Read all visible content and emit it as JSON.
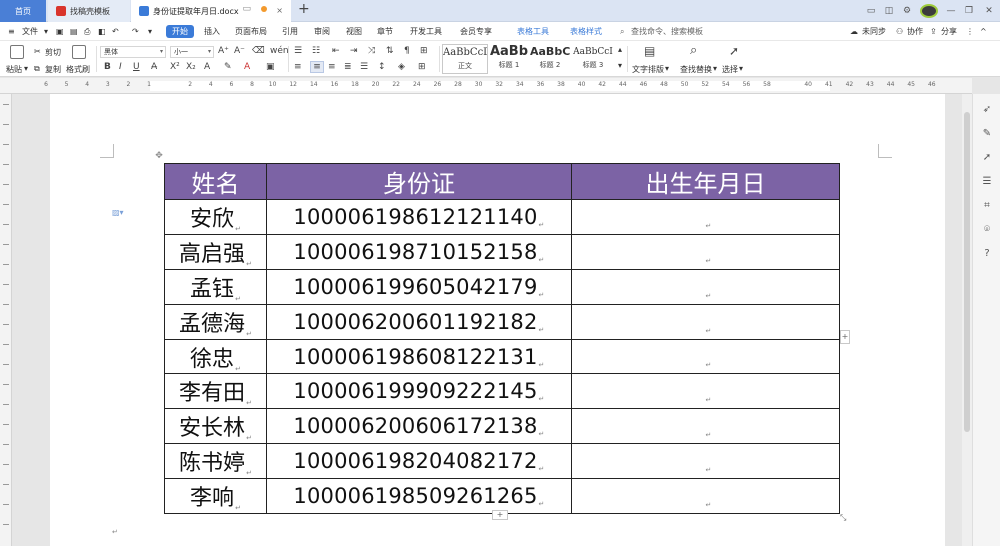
{
  "titlebar": {
    "tabs": [
      {
        "label": "首页"
      },
      {
        "label": "找稿壳模板"
      },
      {
        "label": "身份证提取年月日.docx"
      }
    ],
    "new_tab": "+",
    "close_glyph": "×"
  },
  "menu": {
    "file": "文件",
    "items": [
      "开始",
      "插入",
      "页面布局",
      "引用",
      "审阅",
      "视图",
      "章节",
      "开发工具",
      "会员专享"
    ],
    "context_tabs": [
      "表格工具",
      "表格样式"
    ],
    "search": "查找命令、搜索模板",
    "right": {
      "sync": "未同步",
      "collab": "协作",
      "share": "分享"
    }
  },
  "ribbon": {
    "paste": "粘贴",
    "cut": "剪切",
    "copy": "复制",
    "format_painter": "格式刷",
    "font_name": "黑体",
    "font_size": "小一",
    "styles": [
      {
        "sample": "AaBbCcDd",
        "label": "正文"
      },
      {
        "sample": "AaBb",
        "label": "标题 1"
      },
      {
        "sample": "AaBbC",
        "label": "标题 2"
      },
      {
        "sample": "AaBbCcI",
        "label": "标题 3"
      }
    ],
    "text_layout": "文字排版",
    "find_replace": "查找替换",
    "select": "选择"
  },
  "ruler": {
    "ticks": [
      "6",
      "5",
      "4",
      "3",
      "2",
      "1",
      "",
      "2",
      "4",
      "6",
      "8",
      "10",
      "12",
      "14",
      "16",
      "18",
      "20",
      "22",
      "24",
      "26",
      "28",
      "30",
      "32",
      "34",
      "36",
      "38",
      "40",
      "42",
      "44",
      "46",
      "48",
      "50",
      "52",
      "54",
      "56",
      "58",
      "",
      "40",
      "41",
      "42",
      "43",
      "44",
      "45",
      "46"
    ]
  },
  "table": {
    "headers": [
      "姓名",
      "身份证",
      "出生年月日"
    ],
    "rows": [
      {
        "name": "安欣",
        "id": "100006198612121140"
      },
      {
        "name": "高启强",
        "id": "100006198710152158"
      },
      {
        "name": "孟钰",
        "id": "100006199605042179"
      },
      {
        "name": "孟德海",
        "id": "100006200601192182"
      },
      {
        "name": "徐忠",
        "id": "100006198608122131"
      },
      {
        "name": "李有田",
        "id": "100006199909222145"
      },
      {
        "name": "安长林",
        "id": "100006200606172138"
      },
      {
        "name": "陈书婷",
        "id": "100006198204082172"
      },
      {
        "name": "李响",
        "id": "100006198509261265"
      }
    ],
    "header_color": "#7c63a5"
  },
  "colors": {
    "accent": "#3b7bd8",
    "titlebar": "#dbe4f3"
  }
}
